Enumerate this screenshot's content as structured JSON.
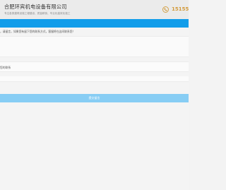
{
  "header": {
    "company_name": "合肥环宾机电设备有限公司",
    "slogan": "专注各类建筑设施工程建设、质量精良、专业化高效化施工",
    "phone_number": "15155",
    "phone_icon": "phone-icon",
    "accent_color": "#d39a3a"
  },
  "nav": {
    "background_color": "#129dea"
  },
  "form": {
    "notice": "，请留言，如果您有留下您的联系方式，客服将在这间联系您！",
    "message_value": "",
    "contact_label": "您的联系",
    "submit_label": "提交留言",
    "submit_color": "#87cdf4"
  }
}
